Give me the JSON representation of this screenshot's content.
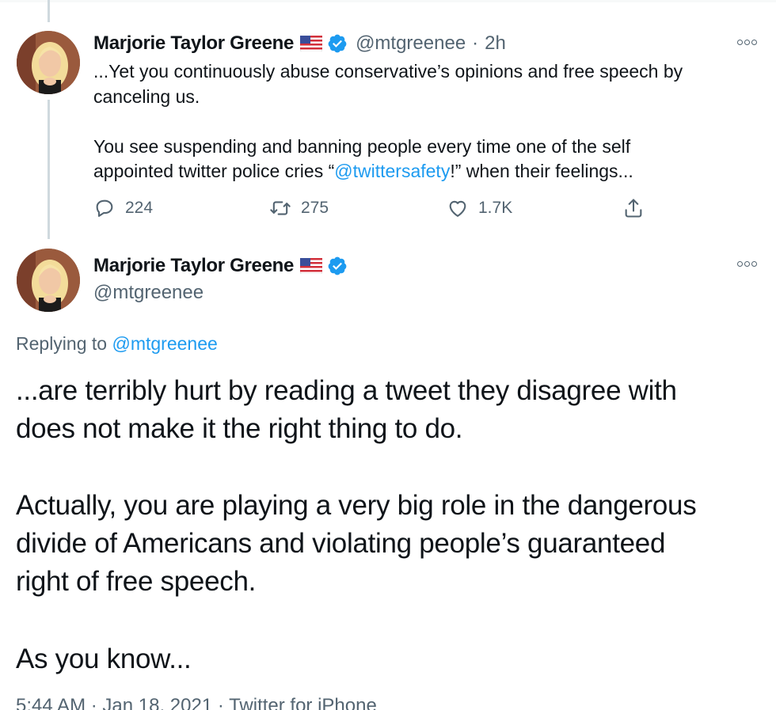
{
  "parent_tweet": {
    "author_name": "Marjorie Taylor Greene",
    "handle": "@mtgreenee",
    "separator": "·",
    "time": "2h",
    "text_line1": "...Yet you continuously abuse conservative’s opinions and free speech by",
    "text_line2": "canceling us.",
    "text_line3": "You see suspending and banning people every time one of the self",
    "text_line4_before": "appointed twitter police cries “",
    "text_line4_mention": "@twittersafety",
    "text_line4_after": "!” when their feelings...",
    "reply_count": "224",
    "retweet_count": "275",
    "like_count": "1.7K"
  },
  "main_tweet": {
    "author_name": "Marjorie Taylor Greene",
    "handle": "@mtgreenee",
    "replying_to_label": "Replying to ",
    "replying_to_handle": "@mtgreenee",
    "line1": "...are terribly hurt by reading a tweet they disagree with",
    "line2": "does not make it the right thing to do.",
    "line3": "Actually, you are playing a very big role in the dangerous",
    "line4": "divide of Americans and violating people’s guaranteed",
    "line5": "right of free speech.",
    "line6": "As you know...",
    "meta": "5:44 AM · Jan 18, 2021 · Twitter for iPhone"
  },
  "colors": {
    "accent": "#1d9bf0",
    "secondary_text": "#536471",
    "primary_text": "#0f1419",
    "thread_line": "#cfd9de"
  },
  "icons": {
    "verified": "verified-badge-icon",
    "flag": "us-flag-icon",
    "more": "more-options-icon",
    "reply": "reply-icon",
    "retweet": "retweet-icon",
    "like": "heart-icon",
    "share": "share-icon"
  }
}
